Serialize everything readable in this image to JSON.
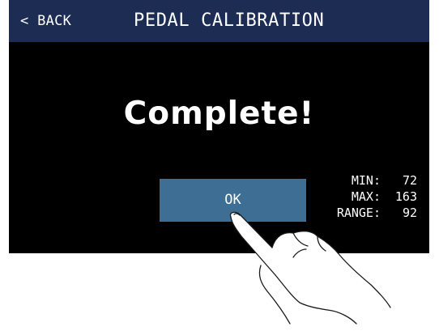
{
  "header": {
    "back_label": "< BACK",
    "title": "PEDAL CALIBRATION"
  },
  "main": {
    "status_text": "Complete!",
    "ok_label": "OK"
  },
  "stats": {
    "min_label": "MIN:",
    "min_value": "72",
    "max_label": "MAX:",
    "max_value": "163",
    "range_label": "RANGE:",
    "range_value": "92"
  },
  "icons": {
    "pointer": "pointing-hand-icon"
  },
  "colors": {
    "header_bg": "#1c2c53",
    "screen_bg": "#000000",
    "ok_button_bg": "#3e6e93",
    "text": "#ffffff"
  }
}
